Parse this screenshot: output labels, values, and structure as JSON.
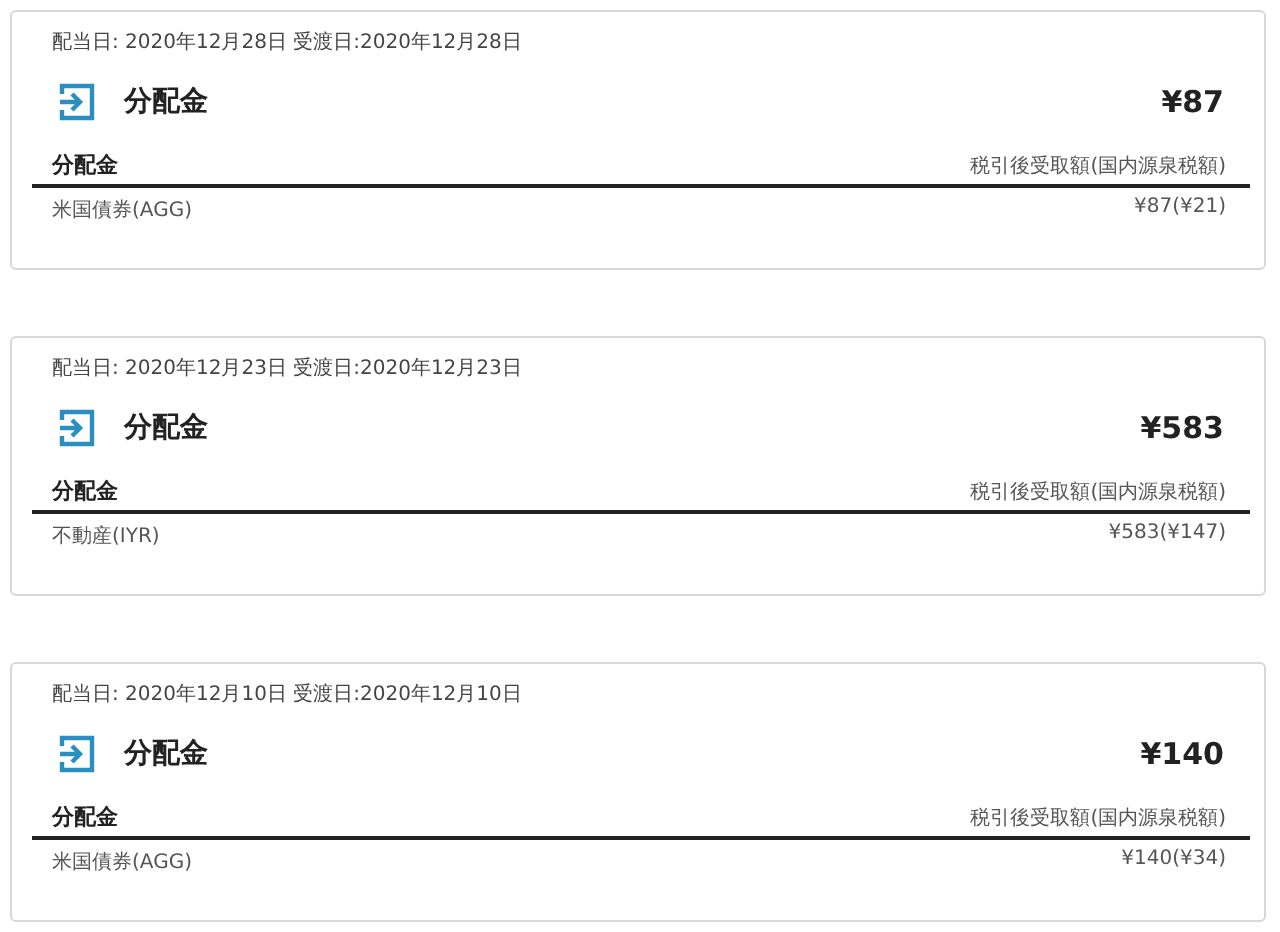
{
  "transactions": [
    {
      "dates": "配当日: 2020年12月28日 受渡日:2020年12月28日",
      "title": "分配金",
      "amount": "¥87",
      "column_left": "分配金",
      "column_right": "税引後受取額(国内源泉税額)",
      "rows": [
        {
          "name": "米国債券(AGG)",
          "value": "¥87(¥21)"
        }
      ]
    },
    {
      "dates": "配当日: 2020年12月23日 受渡日:2020年12月23日",
      "title": "分配金",
      "amount": "¥583",
      "column_left": "分配金",
      "column_right": "税引後受取額(国内源泉税額)",
      "rows": [
        {
          "name": "不動産(IYR)",
          "value": "¥583(¥147)"
        }
      ]
    },
    {
      "dates": "配当日: 2020年12月10日 受渡日:2020年12月10日",
      "title": "分配金",
      "amount": "¥140",
      "column_left": "分配金",
      "column_right": "税引後受取額(国内源泉税額)",
      "rows": [
        {
          "name": "米国債券(AGG)",
          "value": "¥140(¥34)"
        }
      ]
    }
  ]
}
